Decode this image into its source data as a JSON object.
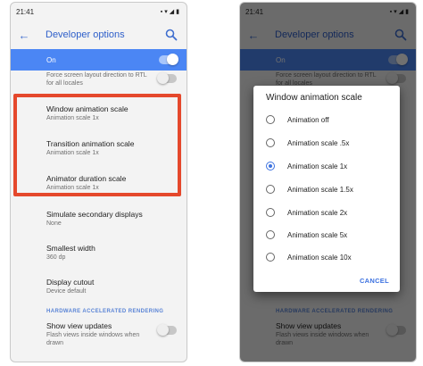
{
  "status": {
    "time": "21:41"
  },
  "toolbar": {
    "title": "Developer options"
  },
  "master_switch": {
    "label": "On",
    "state": "on"
  },
  "settings": {
    "force_rtl": {
      "text": "Force screen layout direction to RTL for all locales"
    },
    "window_animation": {
      "title": "Window animation scale",
      "value": "Animation scale 1x"
    },
    "transition_animation": {
      "title": "Transition animation scale",
      "value": "Animation scale 1x"
    },
    "animator_duration": {
      "title": "Animator duration scale",
      "value": "Animation scale 1x"
    },
    "secondary_displays": {
      "title": "Simulate secondary displays",
      "value": "None"
    },
    "smallest_width": {
      "title": "Smallest width",
      "value": "360 dp"
    },
    "display_cutout": {
      "title": "Display cutout",
      "value": "Device default"
    },
    "hw_section": "HARDWARE ACCELERATED RENDERING",
    "view_updates": {
      "title": "Show view updates",
      "value": "Flash views inside windows when drawn"
    }
  },
  "dialog": {
    "title": "Window animation scale",
    "options": [
      "Animation off",
      "Animation scale .5x",
      "Animation scale 1x",
      "Animation scale 1.5x",
      "Animation scale 2x",
      "Animation scale 5x",
      "Animation scale 10x"
    ],
    "selected": "Animation scale 1x",
    "cancel": "CANCEL"
  },
  "colors": {
    "accent": "#4b86f4",
    "title_blue": "#2e5fca",
    "highlight": "#e5482c"
  }
}
